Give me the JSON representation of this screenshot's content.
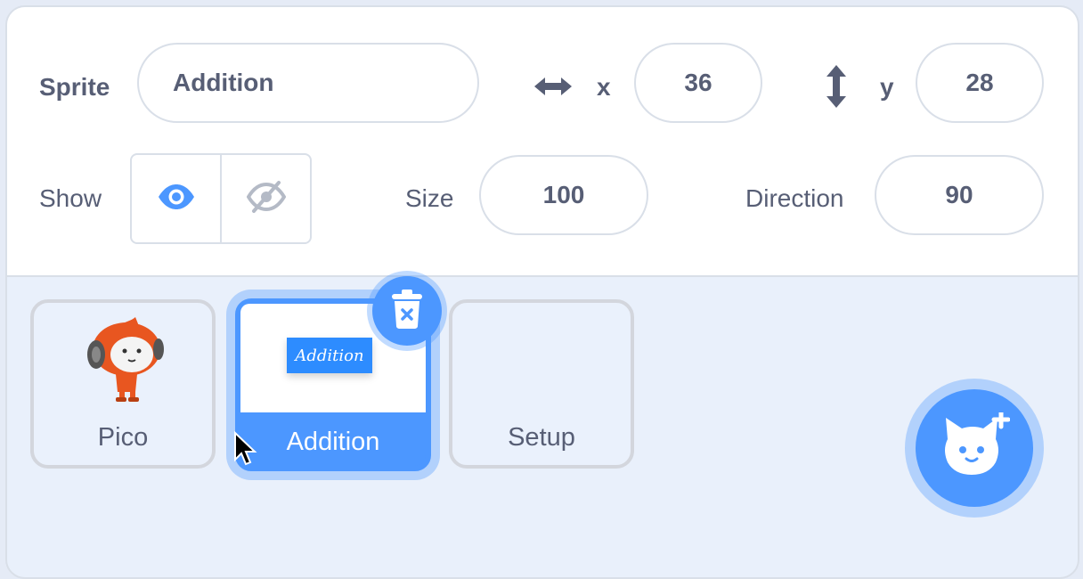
{
  "sprite_info": {
    "sprite_label": "Sprite",
    "sprite_name": "Addition",
    "x_label": "x",
    "x_value": "36",
    "y_label": "y",
    "y_value": "28",
    "show_label": "Show",
    "show_visible_selected": true,
    "size_label": "Size",
    "size_value": "100",
    "direction_label": "Direction",
    "direction_value": "90"
  },
  "sprites": [
    {
      "name": "Pico",
      "selected": false,
      "icon": "pico-sprite-thumbnail"
    },
    {
      "name": "Addition",
      "selected": true,
      "costume_text": "Addition"
    },
    {
      "name": "Setup",
      "selected": false
    }
  ],
  "icons": {
    "delete": "trash-icon",
    "add_sprite": "cat-add-icon",
    "x_axis": "horizontal-arrows-icon",
    "y_axis": "vertical-arrows-icon",
    "show": "eye-icon",
    "hide": "eye-slash-icon"
  },
  "colors": {
    "accent": "#4c97ff",
    "text": "#575e75",
    "border": "#d9dfe8",
    "background": "#e9f0fb"
  }
}
